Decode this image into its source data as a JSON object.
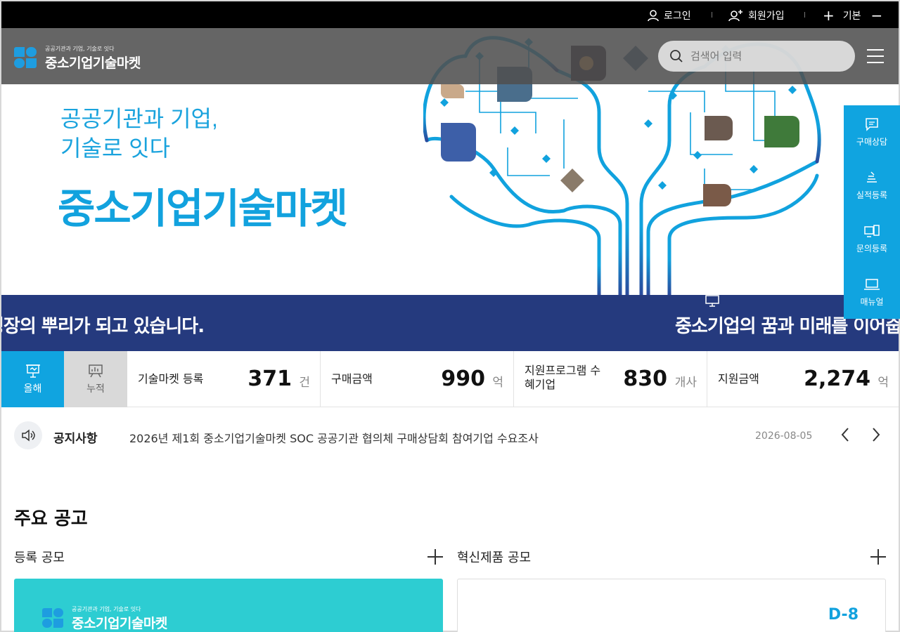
{
  "topbar": {
    "login": "로그인",
    "signup": "회원가입",
    "zoom_label": "기본"
  },
  "header": {
    "logo_small": "공공기관과 기업, 기술로 잇다",
    "logo_big": "중소기업기술마켓",
    "search_placeholder": "검색어 입력"
  },
  "hero": {
    "line1": "공공기관과 기업,",
    "line2": "기술로 잇다",
    "headline": "중소기업기술마켓"
  },
  "quick_menu": [
    {
      "label": "구매상담",
      "icon": "chat-icon"
    },
    {
      "label": "실적등록",
      "icon": "register-icon"
    },
    {
      "label": "문의등록",
      "icon": "device-icon"
    },
    {
      "label": "매뉴얼",
      "icon": "laptop-icon"
    }
  ],
  "band": {
    "text1": "성장의 뿌리가 되고 있습니다.",
    "text2": "중소기업의 꿈과 미래를 이어줍"
  },
  "stats": {
    "tab_this_year": "올해",
    "tab_cumulative": "누적",
    "items": [
      {
        "label": "기술마켓 등록",
        "value": "371",
        "unit": "건"
      },
      {
        "label": "구매금액",
        "value": "990",
        "unit": "억"
      },
      {
        "label": "지원프로그램 수혜기업",
        "value": "830",
        "unit": "개사"
      },
      {
        "label": "지원금액",
        "value": "2,274",
        "unit": "억"
      }
    ]
  },
  "notice": {
    "title": "공지사항",
    "text": "2026년 제1회 중소기업기술마켓 SOC 공공기관 협의체 구매상담회 참여기업 수요조사",
    "date": "2026-08-05"
  },
  "main": {
    "section_title": "주요 공고",
    "col1_title": "등록 공모",
    "col2_title": "혁신제품 공모",
    "card_logo_small": "공공기관과 기업, 기술로 잇다",
    "card_logo_big": "중소기업기술마켓",
    "dday": "D-8"
  },
  "colors": {
    "brand_blue": "#12a2de",
    "band_navy": "#253a7e",
    "card_teal": "#2dcdd2"
  }
}
